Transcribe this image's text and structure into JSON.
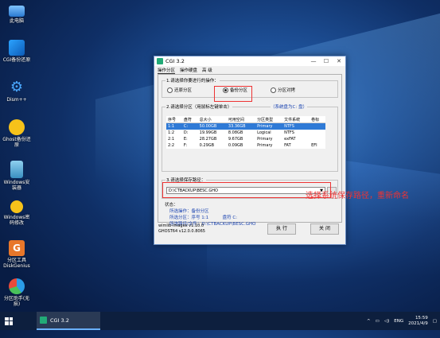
{
  "desktop": {
    "icons": [
      {
        "label": "此电脑",
        "icon": "computer-icon"
      },
      {
        "label": "CGI备份还原",
        "icon": "cgi-backup-icon"
      },
      {
        "label": "Dism++",
        "icon": "gear-icon"
      },
      {
        "label": "Ghost备份还原",
        "icon": "ghost-icon"
      },
      {
        "label": "Windows安装器",
        "icon": "installer-icon"
      },
      {
        "label": "Windows密码修改",
        "icon": "key-icon"
      },
      {
        "label": "分区工具DiskGenius",
        "icon": "diskgenius-icon"
      },
      {
        "label": "分区助手(无损)",
        "icon": "partition-assistant-icon"
      }
    ]
  },
  "window": {
    "title": "CGI 3.2",
    "controls": {
      "minimize": "—",
      "maximize": "☐",
      "close": "✕"
    },
    "tabs": [
      "操作分区",
      "操作硬盘",
      "高 级"
    ],
    "step1": {
      "label": "1.请选择你要进行的操作：",
      "options": [
        "还原分区",
        "备份分区",
        "分区对拷"
      ],
      "selected": "备份分区"
    },
    "step2": {
      "label": "2.请选择分区（用鼠标左键单击）",
      "link": "（系统盘为C: 盘）",
      "columns": [
        "序号",
        "盘符",
        "总大小",
        "可用空间",
        "分区类型",
        "文件系统",
        "卷标"
      ],
      "rows": [
        [
          "1:1",
          "C:",
          "50.00GB",
          "33.36GB",
          "Primary",
          "NTFS",
          ""
        ],
        [
          "1:2",
          "D:",
          "19.99GB",
          "8.08GB",
          "Logical",
          "NTFS",
          ""
        ],
        [
          "2:1",
          "E:",
          "28.27GB",
          "9.67GB",
          "Primary",
          "exFAT",
          ""
        ],
        [
          "2:2",
          "F:",
          "0.29GB",
          "0.09GB",
          "Primary",
          "FAT",
          "EFI"
        ]
      ],
      "selected_row": 0
    },
    "step3": {
      "label": "3.请选择保存路径：",
      "path": "D:\\CTBACKUP\\BESC.GHO"
    },
    "status": {
      "title": "状态：",
      "lines": [
        {
          "key": "所选操作：",
          "value": "备份分区"
        },
        {
          "key": "所选分区：",
          "value": "序号 1:1          盘符 C:"
        },
        {
          "key": "所选路径/文件：",
          "value": "D:\\CTBACKUP\\BESC.GHO"
        }
      ]
    },
    "footer": {
      "line1": "wimlib-imagex v1.10.0",
      "line2": "GHOST64 v12.0.0.8065"
    },
    "buttons": {
      "execute": "执 行",
      "close": "关 闭"
    }
  },
  "annotation": "选择系统保存路径，重新命名",
  "taskbar": {
    "task_label": "CGI 3.2",
    "lang": "ENG",
    "time": "15:59",
    "date": "2021/4/9"
  },
  "colors": {
    "highlight": "#e33333",
    "selection": "#2f7ad6",
    "accent": "#6ab0ff"
  }
}
